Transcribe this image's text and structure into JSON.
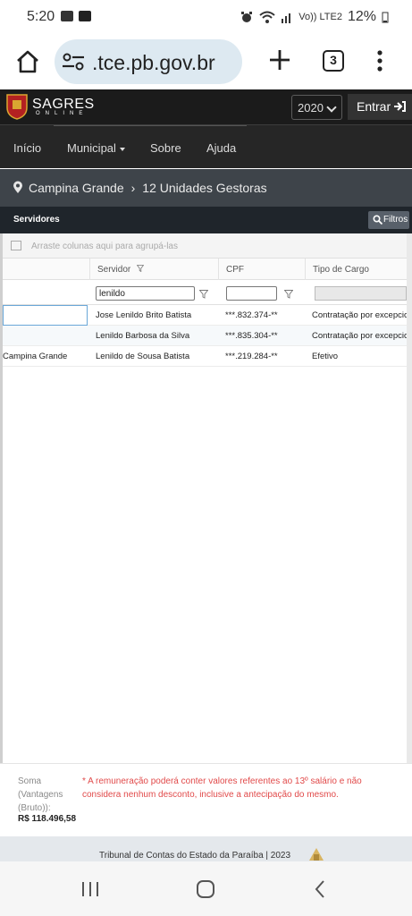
{
  "status_bar": {
    "time": "5:20",
    "network": "Vo)) LTE2",
    "battery": "12%",
    "icons": [
      "gallery-icon",
      "youtube-icon",
      "alarm-icon",
      "wifi-icon",
      "signal-icon",
      "battery-icon"
    ]
  },
  "browser": {
    "url": ".tce.pb.gov.br",
    "tab_count": "3",
    "icons": [
      "home-icon",
      "site-settings-icon",
      "new-tab-icon",
      "tabs-icon",
      "more-menu-icon"
    ]
  },
  "site_header": {
    "logo_title": "SAGRES",
    "logo_subtitle": "ONLINE",
    "year": "2020",
    "login_label": "Entrar"
  },
  "nav": {
    "items": [
      "Início",
      "Municipal",
      "Sobre",
      "Ajuda"
    ]
  },
  "breadcrumb": {
    "city": "Campina Grande",
    "units": "12 Unidades Gestoras"
  },
  "panel": {
    "title": "Servidores",
    "filters_label": "Filtros"
  },
  "grid": {
    "group_hint": "Arraste colunas aqui para agrupá-las",
    "columns": [
      "",
      "Servidor",
      "CPF",
      "Tipo de Cargo"
    ],
    "filters": {
      "servidor": "lenildo",
      "cpf": ""
    },
    "rows": [
      {
        "unidade": "",
        "servidor": "Jose Lenildo Brito Batista",
        "cpf": "***.832.374-**",
        "tipo": "Contratação por excepcio"
      },
      {
        "unidade": "",
        "servidor": "Lenildo Barbosa da Silva",
        "cpf": "***.835.304-**",
        "tipo": "Contratação por excepcio"
      },
      {
        "unidade": "Campina Grande",
        "servidor": "Lenildo de Sousa Batista",
        "cpf": "***.219.284-**",
        "tipo": "Efetivo"
      }
    ]
  },
  "summary": {
    "label": "Soma (Vantagens (Bruto)):",
    "value": "R$ 118.496,58",
    "note": "* A remuneração poderá conter valores referentes ao 13º salário e não considera nenhum desconto, inclusive a antecipação do mesmo."
  },
  "footer": {
    "text": "Tribunal de Contas do Estado da Paraíba | 2023"
  },
  "colors": {
    "header_bg": "#1b1b1b",
    "nav_bg": "#262626",
    "breadcrumb_bg": "#3e444a",
    "panel_bg": "#1f252b",
    "note_red": "#e14a4a",
    "url_pill": "#dde9f1"
  }
}
